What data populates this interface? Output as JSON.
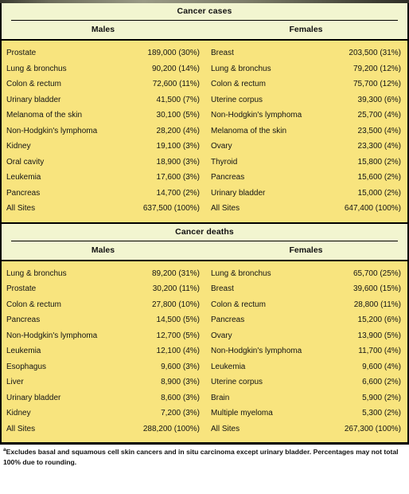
{
  "figure": {
    "top_strip": "decorative-dark-gradient-bar"
  },
  "tables": [
    {
      "title": "Cancer cases",
      "columns": [
        "Males",
        "Females"
      ],
      "males": [
        {
          "site": "Prostate",
          "value": "189,000 (30%)"
        },
        {
          "site": "Lung & bronchus",
          "value": "90,200 (14%)"
        },
        {
          "site": "Colon & rectum",
          "value": "72,600 (11%)"
        },
        {
          "site": "Urinary bladder",
          "value": "41,500 (7%)"
        },
        {
          "site": "Melanoma of the skin",
          "value": "30,100 (5%)"
        },
        {
          "site": "Non-Hodgkin's lymphoma",
          "value": "28,200 (4%)"
        },
        {
          "site": "Kidney",
          "value": "19,100 (3%)"
        },
        {
          "site": "Oral cavity",
          "value": "18,900 (3%)"
        },
        {
          "site": "Leukemia",
          "value": "17,600 (3%)"
        },
        {
          "site": "Pancreas",
          "value": "14,700 (2%)"
        },
        {
          "site": "All Sites",
          "value": "637,500 (100%)"
        }
      ],
      "females": [
        {
          "site": "Breast",
          "value": "203,500 (31%)"
        },
        {
          "site": "Lung & bronchus",
          "value": "79,200 (12%)"
        },
        {
          "site": "Colon & rectum",
          "value": "75,700 (12%)"
        },
        {
          "site": "Uterine corpus",
          "value": "39,300 (6%)"
        },
        {
          "site": "Non-Hodgkin's lymphoma",
          "value": "25,700 (4%)"
        },
        {
          "site": "Melanoma of the skin",
          "value": "23,500 (4%)"
        },
        {
          "site": "Ovary",
          "value": "23,300 (4%)"
        },
        {
          "site": "Thyroid",
          "value": "15,800 (2%)"
        },
        {
          "site": "Pancreas",
          "value": "15,600 (2%)"
        },
        {
          "site": "Urinary bladder",
          "value": "15,000 (2%)"
        },
        {
          "site": "All Sites",
          "value": "647,400 (100%)"
        }
      ]
    },
    {
      "title": "Cancer deaths",
      "columns": [
        "Males",
        "Females"
      ],
      "males": [
        {
          "site": "Lung & bronchus",
          "value": "89,200 (31%)"
        },
        {
          "site": "Prostate",
          "value": "30,200 (11%)"
        },
        {
          "site": "Colon & rectum",
          "value": "27,800 (10%)"
        },
        {
          "site": "Pancreas",
          "value": "14,500 (5%)"
        },
        {
          "site": "Non-Hodgkin's lymphoma",
          "value": "12,700 (5%)"
        },
        {
          "site": "Leukemia",
          "value": "12,100 (4%)"
        },
        {
          "site": "Esophagus",
          "value": "9,600 (3%)"
        },
        {
          "site": "Liver",
          "value": "8,900 (3%)"
        },
        {
          "site": "Urinary bladder",
          "value": "8,600 (3%)"
        },
        {
          "site": "Kidney",
          "value": "7,200 (3%)"
        },
        {
          "site": "All Sites",
          "value": "288,200 (100%)"
        }
      ],
      "females": [
        {
          "site": "Lung & bronchus",
          "value": "65,700 (25%)"
        },
        {
          "site": "Breast",
          "value": "39,600 (15%)"
        },
        {
          "site": "Colon & rectum",
          "value": "28,800 (11%)"
        },
        {
          "site": "Pancreas",
          "value": "15,200 (6%)"
        },
        {
          "site": "Ovary",
          "value": "13,900 (5%)"
        },
        {
          "site": "Non-Hodgkin's lymphoma",
          "value": "11,700 (4%)"
        },
        {
          "site": "Leukemia",
          "value": "9,600 (4%)"
        },
        {
          "site": "Uterine corpus",
          "value": "6,600 (2%)"
        },
        {
          "site": "Brain",
          "value": "5,900 (2%)"
        },
        {
          "site": "Multiple myeloma",
          "value": "5,300 (2%)"
        },
        {
          "site": "All Sites",
          "value": "267,300 (100%)"
        }
      ]
    }
  ],
  "footnote": {
    "marker": "a",
    "text": "Excludes basal and squamous cell skin cancers and in situ carcinoma except urinary bladder. Percentages may not total 100% due to rounding."
  },
  "colors": {
    "header_bg": "#f2f5d0",
    "body_bg": "#f8e47e",
    "rule": "#000000",
    "text": "#141414"
  }
}
